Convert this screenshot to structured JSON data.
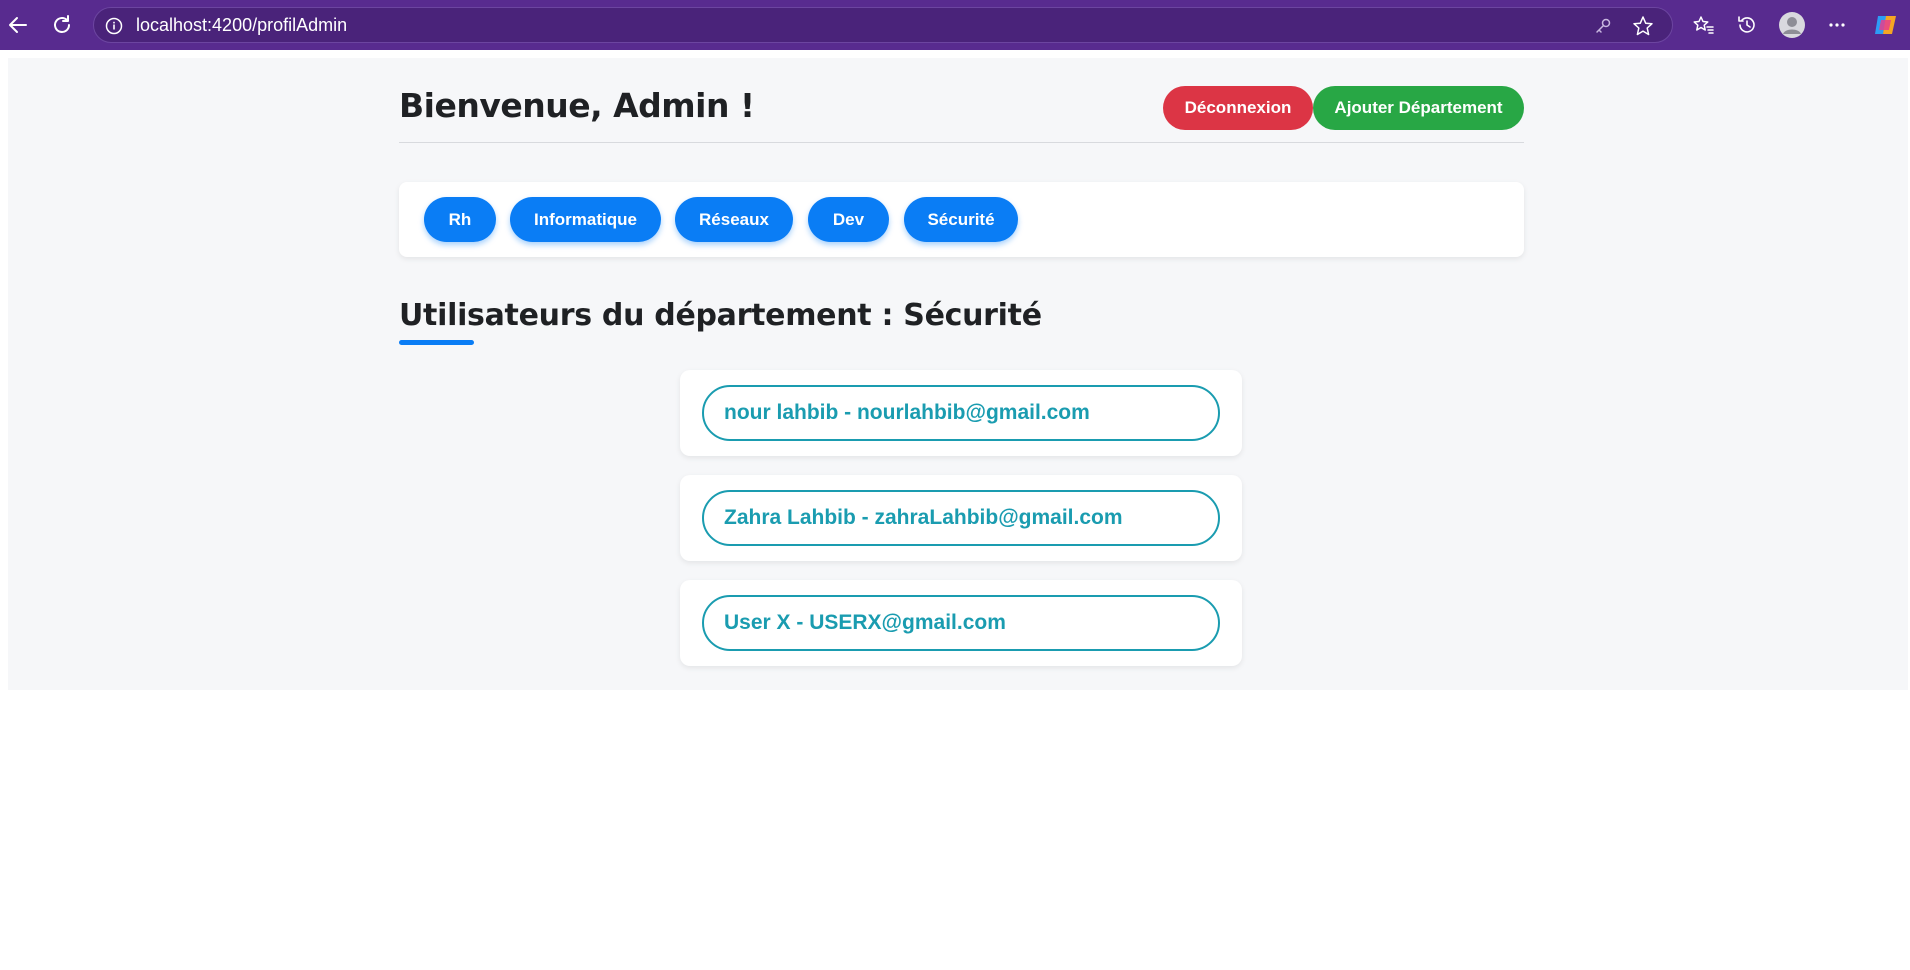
{
  "browser": {
    "url": "localhost:4200/profilAdmin"
  },
  "header": {
    "title": "Bienvenue, Admin !",
    "logout_label": "Déconnexion",
    "add_department_label": "Ajouter Département"
  },
  "departments": {
    "items": [
      {
        "label": "Rh"
      },
      {
        "label": "Informatique"
      },
      {
        "label": "Réseaux"
      },
      {
        "label": "Dev"
      },
      {
        "label": "Sécurité"
      }
    ]
  },
  "users_section": {
    "title": "Utilisateurs du département : Sécurité",
    "users": [
      {
        "label": "nour lahbib - nourlahbib@gmail.com"
      },
      {
        "label": "Zahra Lahbib - zahraLahbib@gmail.com"
      },
      {
        "label": "User X - USERX@gmail.com"
      }
    ]
  },
  "colors": {
    "chrome": "#582b8f",
    "primary": "#0a7df5",
    "danger": "#dc3545",
    "success": "#28a745",
    "user_accent": "#1a9cb0"
  }
}
